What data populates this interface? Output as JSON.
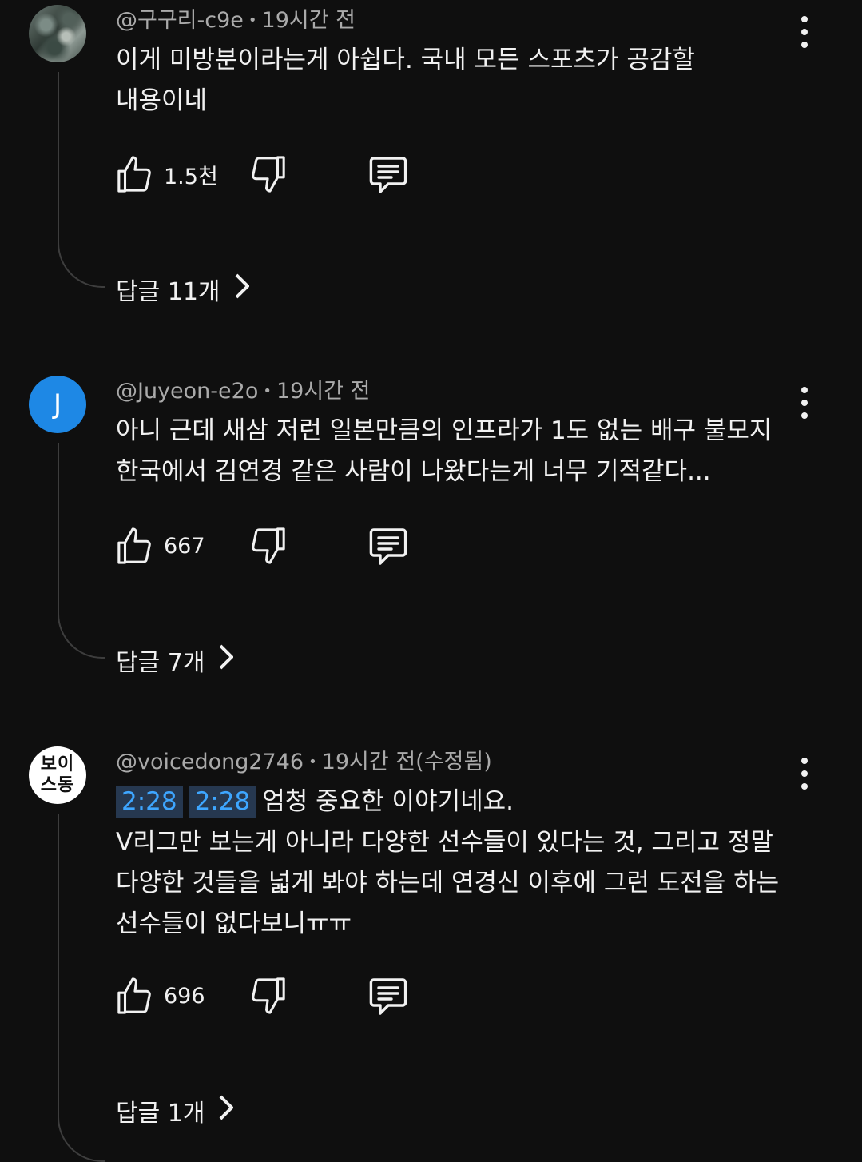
{
  "comments": [
    {
      "author": "@구구리-c9e",
      "time": "19시간 전",
      "avatar": {
        "type": "photo",
        "label": ""
      },
      "lines": [
        "이게 미방분이라는게 아쉽다. 국내 모든 스포츠가 공감할",
        "내용이네"
      ],
      "timestamps": [],
      "likes": "1.5천",
      "replies": "답글 11개"
    },
    {
      "author": "@Juyeon-e2o",
      "time": "19시간 전",
      "avatar": {
        "type": "letter",
        "label": "J",
        "color": "#1e88e5"
      },
      "lines": [
        "아니 근데 새삼 저런 일본만큼의 인프라가 1도 없는 배구 불모지",
        "한국에서 김연경 같은 사람이 나왔다는게 너무 기적같다..."
      ],
      "timestamps": [],
      "likes": "667",
      "replies": "답글 7개"
    },
    {
      "author": "@voicedong2746",
      "time": "19시간 전(수정됨)",
      "avatar": {
        "type": "text",
        "label_line1": "보이",
        "label_line2": "스동"
      },
      "timestamps": [
        "2:28",
        "2:28"
      ],
      "first_line_rest": "엄청 중요한 이야기네요.",
      "lines": [
        "V리그만 보는게 아니라 다양한 선수들이 있다는 것, 그리고 정말",
        "다양한 것들을 넓게 봐야 하는데 연경신 이후에 그런 도전을 하는",
        "선수들이 없다보니ㅠㅠ"
      ],
      "likes": "696",
      "replies": "답글 1개"
    }
  ],
  "icons": {
    "like": "thumb-up-icon",
    "dislike": "thumb-down-icon",
    "reply": "comment-icon",
    "more": "more-vert-icon",
    "chevron": "chevron-right-icon"
  },
  "colors": {
    "background": "#0f0f0f",
    "secondary_text": "#aaaaaa",
    "timestamp_link": "#3ea6ff",
    "timestamp_bg": "#263850"
  }
}
